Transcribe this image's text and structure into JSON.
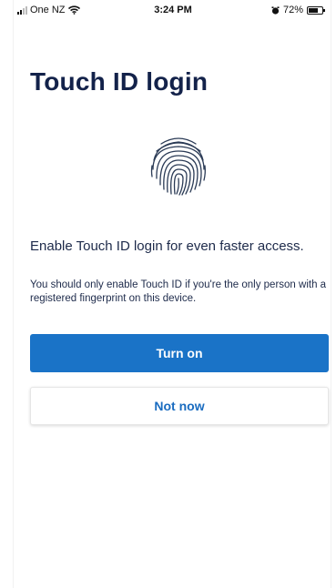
{
  "status_bar": {
    "carrier": "One NZ",
    "time": "3:24 PM",
    "battery": "72%",
    "battery_level": 0.72,
    "icons": [
      "signal-icon",
      "wifi-icon",
      "alarm-icon",
      "battery-icon"
    ]
  },
  "screen": {
    "title": "Touch ID login",
    "icon": "fingerprint-icon",
    "lead": "Enable Touch ID login for even faster access.",
    "note": "You should only enable Touch ID if you're the only person with a registered fingerprint on this device."
  },
  "actions": {
    "primary_label": "Turn on",
    "secondary_label": "Not now"
  },
  "colors": {
    "title": "#13224a",
    "primary_button": "#1a73c7",
    "secondary_text": "#1a6cc0",
    "fingerprint": "#2a3a55"
  }
}
